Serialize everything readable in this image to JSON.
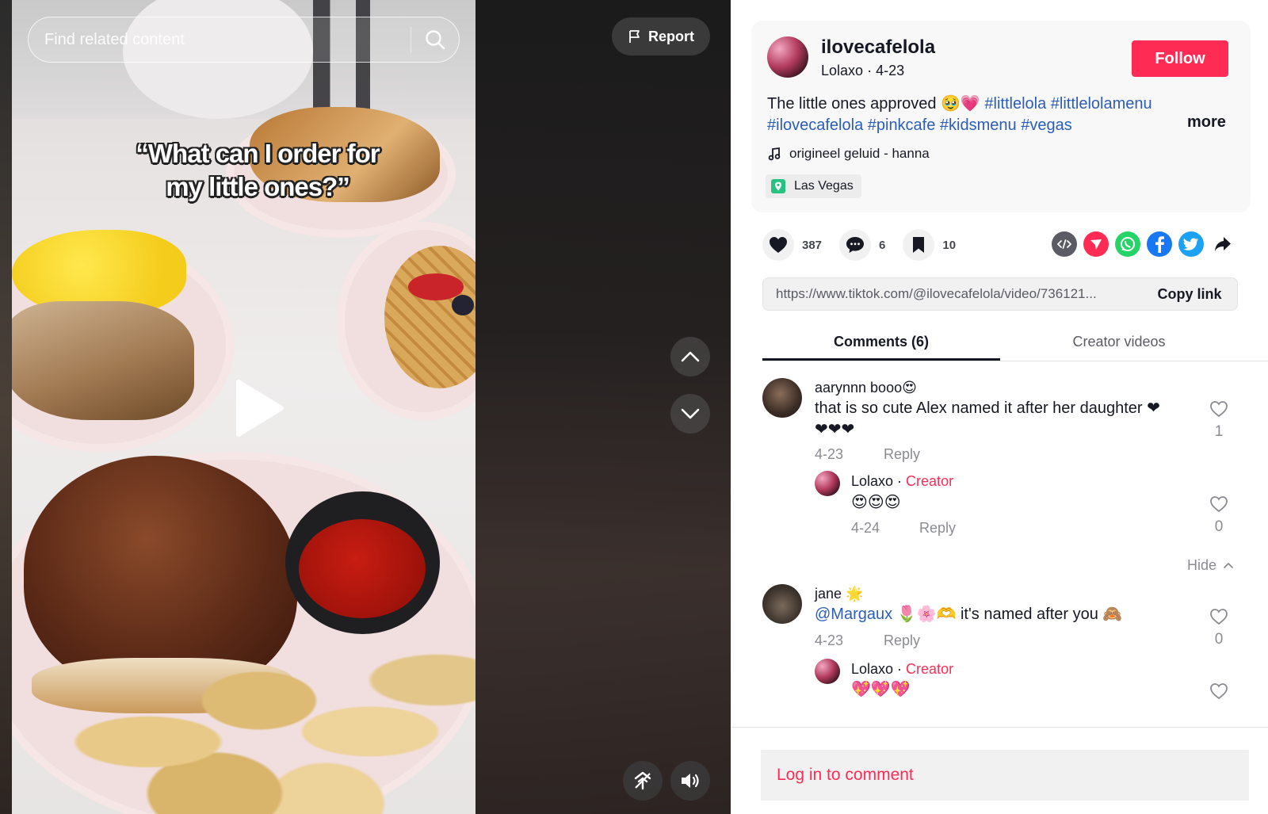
{
  "video": {
    "search_placeholder": "Find related content",
    "caption_line1": "“What can I order for",
    "caption_line2": "my little ones?”",
    "report_label": "Report"
  },
  "post": {
    "username": "ilovecafelola",
    "nickname": "Lolaxo",
    "date": "4-23",
    "follow_label": "Follow",
    "description_text": "The little ones approved 🥹💗 ",
    "hashtags_line1": "#littlelola #littlelolamenu",
    "hashtags_line2": "#ilovecafelola #pinkcafe #kidsmenu #vegas",
    "more_label": "more",
    "music": "origineel geluid - hanna",
    "location": "Las Vegas"
  },
  "actions": {
    "likes": "387",
    "comments": "6",
    "saves": "10"
  },
  "share": {
    "icons": [
      "embed-icon",
      "send-icon",
      "whatsapp-icon",
      "facebook-icon",
      "twitter-icon",
      "share-arrow-icon"
    ]
  },
  "link": {
    "url": "https://www.tiktok.com/@ilovecafelola/video/736121...",
    "copy_label": "Copy link"
  },
  "tabs": [
    "Comments (6)",
    "Creator videos"
  ],
  "comments": [
    {
      "name": "aarynnn booo😍",
      "text_line1": "that is so cute Alex named it after her daughter ❤",
      "text_line2": "❤❤❤",
      "date": "4-23",
      "reply_label": "Reply",
      "likes": "1",
      "replies": [
        {
          "name": "Lolaxo",
          "creator_label": "Creator",
          "text": "😍😍😍",
          "date": "4-24",
          "reply_label": "Reply",
          "likes": "0"
        }
      ],
      "hide_label": "Hide"
    },
    {
      "name": "jane 🌟",
      "mention": "@Margaux",
      "text": " 🌷🌸🫶 it's named after you 🙈",
      "date": "4-23",
      "reply_label": "Reply",
      "likes": "0",
      "replies": [
        {
          "name": "Lolaxo",
          "creator_label": "Creator",
          "text": "💖💖💖"
        }
      ]
    }
  ],
  "footer": {
    "login_label": "Log in to comment"
  },
  "colors": {
    "accent": "#fe2c55",
    "hashtag": "#2b5db9",
    "muted": "#8a8b91"
  }
}
